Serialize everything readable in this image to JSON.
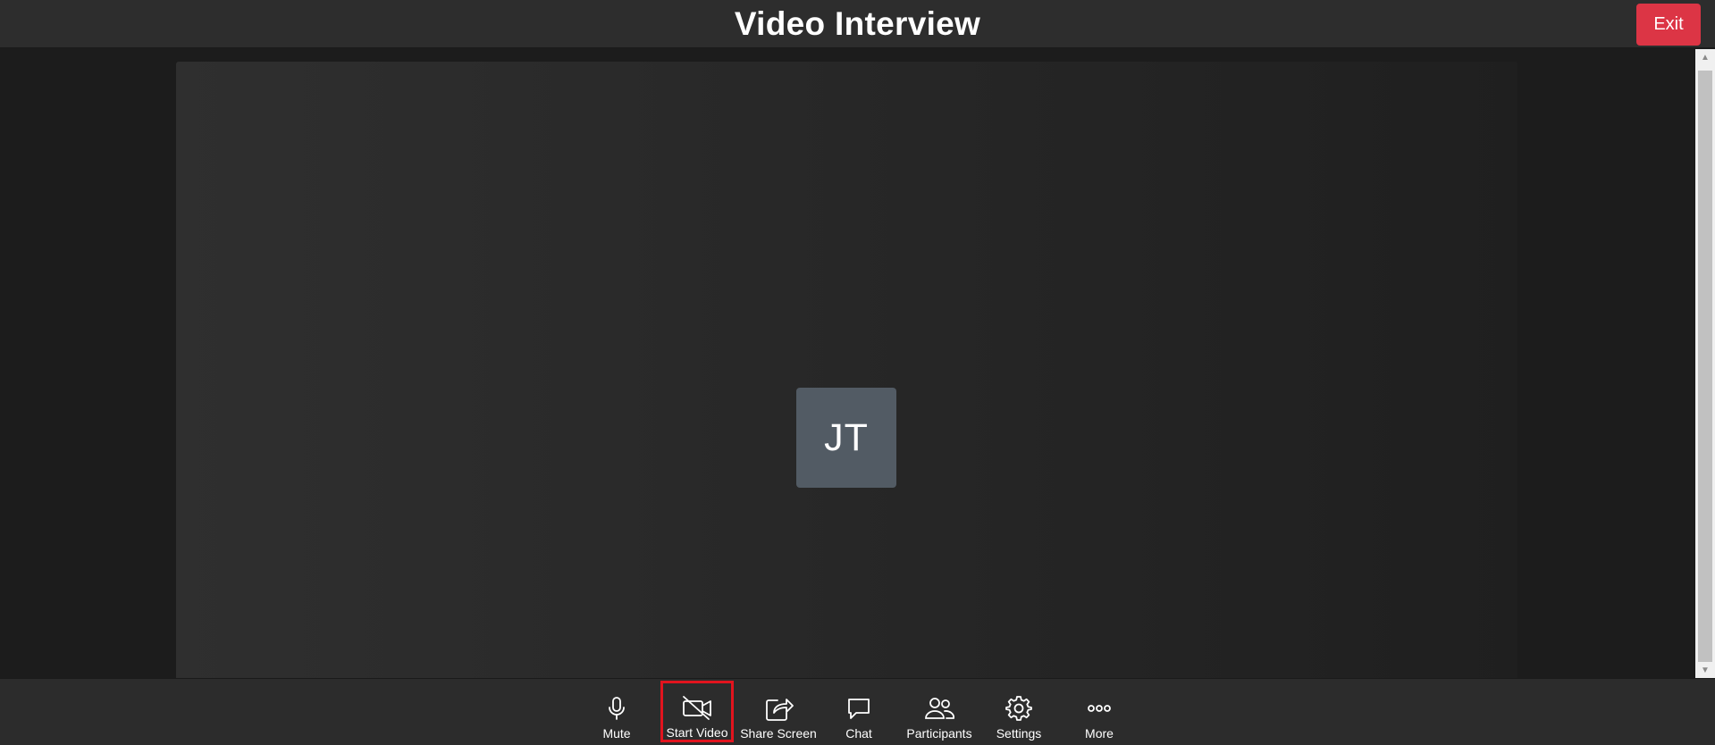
{
  "header": {
    "title": "Video Interview",
    "exit_label": "Exit"
  },
  "stage": {
    "participant_initials": "JT"
  },
  "toolbar": {
    "items": [
      {
        "label": "Mute",
        "icon": "microphone-icon"
      },
      {
        "label": "Start Video",
        "icon": "video-off-icon",
        "highlighted": true
      },
      {
        "label": "Share Screen",
        "icon": "share-screen-icon"
      },
      {
        "label": "Chat",
        "icon": "chat-icon"
      },
      {
        "label": "Participants",
        "icon": "participants-icon"
      },
      {
        "label": "Settings",
        "icon": "gear-icon"
      },
      {
        "label": "More",
        "icon": "more-icon"
      }
    ]
  },
  "colors": {
    "exit_button": "#dc3545",
    "highlight_border": "#e1141e",
    "avatar_bg": "#525b64"
  }
}
